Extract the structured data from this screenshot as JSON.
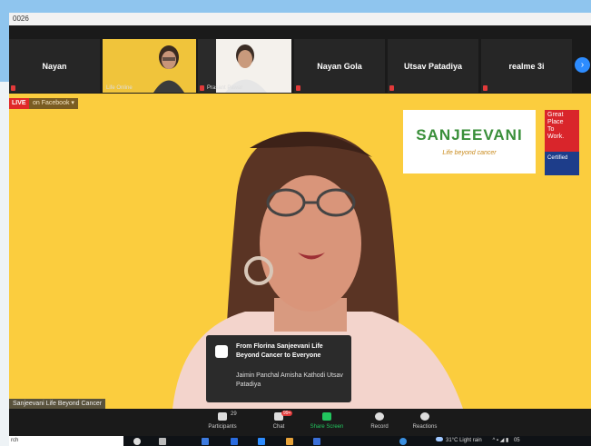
{
  "window": {
    "title": "0026"
  },
  "participants": [
    {
      "name": "Nayan",
      "muted": true
    },
    {
      "name": "Life Online",
      "muted": false
    },
    {
      "name": "Prasant Pawar",
      "muted": true
    },
    {
      "name": "Nayan Gola",
      "muted": true
    },
    {
      "name": "Utsav Patadiya",
      "muted": true
    },
    {
      "name": "realme 3i",
      "muted": true
    }
  ],
  "stream": {
    "live_label": "LIVE",
    "platform_label": "on Facebook"
  },
  "logo": {
    "text": "SANJEEVANI",
    "tagline": "Life beyond cancer",
    "badge_line1": "Great",
    "badge_line2": "Place",
    "badge_line3": "To",
    "badge_line4": "Work.",
    "badge_certified": "Certified"
  },
  "video_caption": "Sanjeevani Life Beyond Cancer",
  "chat_notification": {
    "title": "From Florina Sanjeevani Life Beyond Cancer to Everyone",
    "sender_line": "Jaimin Panchal Amisha Kathodi Utsav Patadiya"
  },
  "toolbar": {
    "participants_label": "Participants",
    "participants_count": "29",
    "chat_label": "Chat",
    "chat_badge": "99+",
    "share_label": "Share Screen",
    "record_label": "Record",
    "reactions_label": "Reactions"
  },
  "taskbar": {
    "search_text": "rch",
    "weather": "31°C Light rain",
    "clock": "05"
  },
  "colors": {
    "stage_bg": "#fbcd3e",
    "share_green": "#22c55e",
    "live_red": "#e02828",
    "zoom_blue": "#2d8cff"
  }
}
